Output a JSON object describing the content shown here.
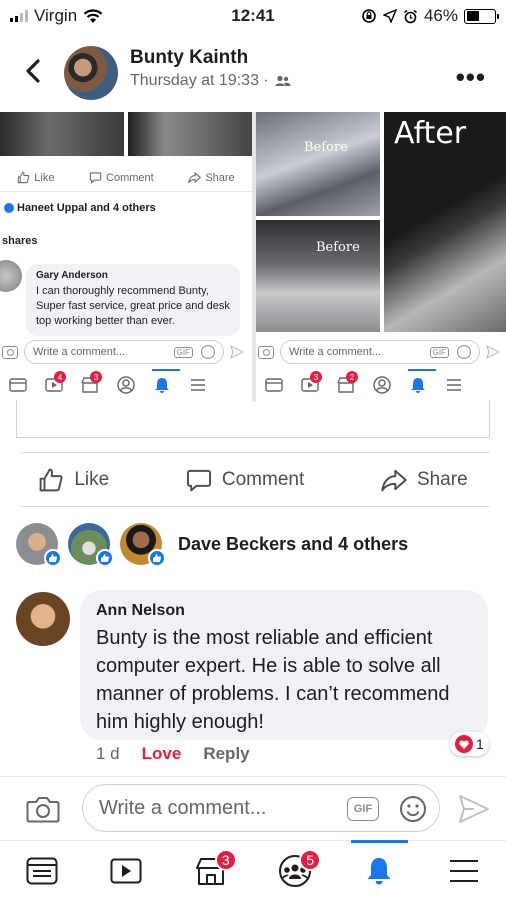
{
  "status_bar": {
    "carrier": "Virgin",
    "time": "12:41",
    "battery": "46%"
  },
  "header": {
    "poster_name": "Bunty Kainth",
    "timestamp": "Thursday at 19:33 ·"
  },
  "embedded": {
    "left": {
      "actions": [
        "Like",
        "Comment",
        "Share"
      ],
      "reactions_text": "Haneet Uppal and 4 others",
      "shares_text": "shares",
      "comment_author": "Gary Anderson",
      "comment_text": "I can thoroughly recommend Bunty, Super fast service, great price and desk top working better than ever.",
      "compose_placeholder": "Write a comment...",
      "nav_badges": [
        "4",
        "3"
      ]
    },
    "right": {
      "labels": [
        "Before",
        "Before",
        "After"
      ],
      "compose_placeholder": "Write a comment...",
      "nav_badges": [
        "3",
        "2"
      ]
    },
    "gif_label": "GIF"
  },
  "actions": {
    "like": "Like",
    "comment": "Comment",
    "share": "Share"
  },
  "reactions": {
    "summary": "Dave Beckers and 4 others"
  },
  "comment": {
    "author": "Ann Nelson",
    "text": "Bunty is the most reliable and efficient computer expert. He is able to solve all manner of problems. I can’t recommend him highly enough!",
    "age": "1 d",
    "love_label": "Love",
    "reply_label": "Reply",
    "love_count": "1"
  },
  "composer": {
    "placeholder": "Write a comment...",
    "gif_label": "GIF"
  },
  "tabbar": {
    "marketplace_badge": "3",
    "groups_badge": "5"
  },
  "colors": {
    "accent": "#1877f2",
    "badge": "#e41e3f",
    "bubble": "#f0f2f5"
  }
}
